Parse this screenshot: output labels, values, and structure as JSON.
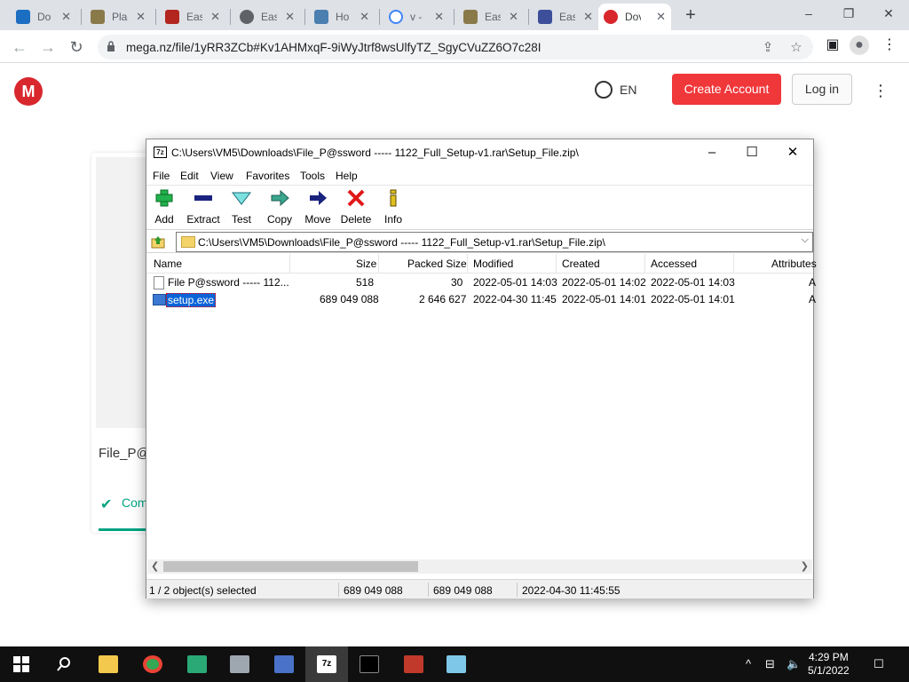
{
  "browser": {
    "tabs": [
      {
        "label": "Do",
        "active": false
      },
      {
        "label": "Plac",
        "active": false
      },
      {
        "label": "Eas",
        "active": false
      },
      {
        "label": "Eas",
        "active": false
      },
      {
        "label": "Ho",
        "active": false
      },
      {
        "label": "v -",
        "active": false
      },
      {
        "label": "Eas",
        "active": false
      },
      {
        "label": "Eas",
        "active": false
      },
      {
        "label": "Dov",
        "active": true
      }
    ],
    "url": "mega.nz/file/1yRR3ZCb#Kv1AHMxqF-9iWyJtrf8wsUlfyTZ_SgyCVuZZ6O7c28I"
  },
  "mega": {
    "logo": "M",
    "language": "EN",
    "create_account": "Create Account",
    "login": "Log in",
    "card_filename": "File_P@",
    "card_status": "Com"
  },
  "sevenzip": {
    "title": "C:\\Users\\VM5\\Downloads\\File_P@ssword ----- 1122_Full_Setup-v1.rar\\Setup_File.zip\\",
    "menu": [
      "File",
      "Edit",
      "View",
      "Favorites",
      "Tools",
      "Help"
    ],
    "toolbar": [
      "Add",
      "Extract",
      "Test",
      "Copy",
      "Move",
      "Delete",
      "Info"
    ],
    "address": "C:\\Users\\VM5\\Downloads\\File_P@ssword ----- 1122_Full_Setup-v1.rar\\Setup_File.zip\\",
    "columns": [
      "Name",
      "Size",
      "Packed Size",
      "Modified",
      "Created",
      "Accessed",
      "Attributes"
    ],
    "rows": [
      {
        "name": "File P@ssword ----- 112...",
        "size": "518",
        "packed": "30",
        "modified": "2022-05-01 14:03",
        "created": "2022-05-01 14:02",
        "accessed": "2022-05-01 14:03",
        "attr": "A"
      },
      {
        "name": "setup.exe",
        "size": "689 049 088",
        "packed": "2 646 627",
        "modified": "2022-04-30 11:45",
        "created": "2022-05-01 14:01",
        "accessed": "2022-05-01 14:01",
        "attr": "A"
      }
    ],
    "status": {
      "selected": "1 / 2 object(s) selected",
      "size": "689 049 088",
      "packed": "689 049 088",
      "modified": "2022-04-30 11:45:55"
    }
  },
  "taskbar": {
    "time": "4:29 PM",
    "date": "5/1/2022"
  }
}
